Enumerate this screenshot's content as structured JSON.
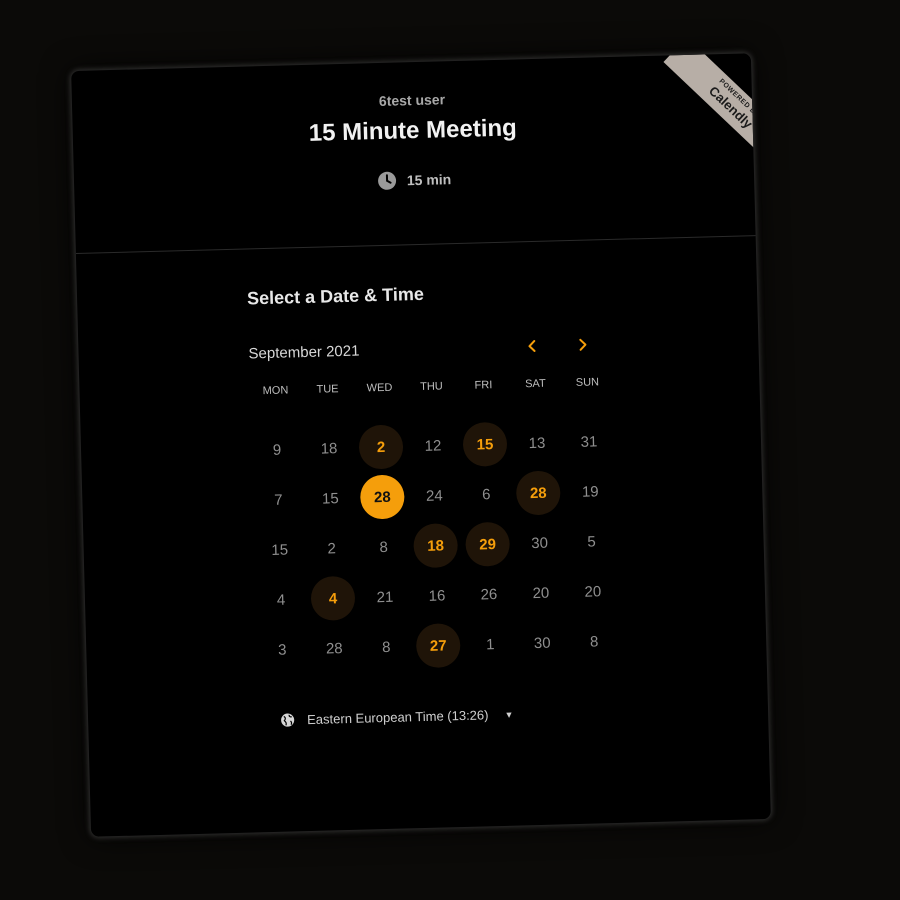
{
  "header": {
    "host": "6test user",
    "title": "15 Minute Meeting",
    "duration": "15 min"
  },
  "badge": {
    "small": "POWERED BY",
    "big": "Calendly"
  },
  "scheduler": {
    "section_title": "Select a Date & Time",
    "month": "September 2021",
    "prev_icon": "chevron-left-icon",
    "next_icon": "chevron-right-icon",
    "weekdays": [
      "MON",
      "TUE",
      "WED",
      "THU",
      "FRI",
      "SAT",
      "SUN"
    ],
    "weeks": [
      [
        {
          "d": "9"
        },
        {
          "d": "18"
        },
        {
          "d": "2",
          "s": "available"
        },
        {
          "d": "12"
        },
        {
          "d": "15",
          "s": "available"
        },
        {
          "d": "13"
        },
        {
          "d": "31"
        }
      ],
      [
        {
          "d": "7"
        },
        {
          "d": "15"
        },
        {
          "d": "28",
          "s": "selected"
        },
        {
          "d": "24"
        },
        {
          "d": "6"
        },
        {
          "d": "28",
          "s": "available"
        },
        {
          "d": "19"
        }
      ],
      [
        {
          "d": "15"
        },
        {
          "d": "2"
        },
        {
          "d": "8"
        },
        {
          "d": "18",
          "s": "available"
        },
        {
          "d": "29",
          "s": "available"
        },
        {
          "d": "30"
        },
        {
          "d": "5"
        }
      ],
      [
        {
          "d": "4"
        },
        {
          "d": "4",
          "s": "available"
        },
        {
          "d": "21"
        },
        {
          "d": "16"
        },
        {
          "d": "26"
        },
        {
          "d": "20"
        },
        {
          "d": "20"
        }
      ],
      [
        {
          "d": "3"
        },
        {
          "d": "28"
        },
        {
          "d": "8"
        },
        {
          "d": "27",
          "s": "available"
        },
        {
          "d": "1"
        },
        {
          "d": "30"
        },
        {
          "d": "8"
        }
      ]
    ],
    "timezone": "Eastern European Time (13:26)"
  },
  "colors": {
    "accent": "#f59e0b",
    "available_bg": "#1f1408",
    "card_bg": "#000000",
    "page_bg": "#0b0a08"
  }
}
